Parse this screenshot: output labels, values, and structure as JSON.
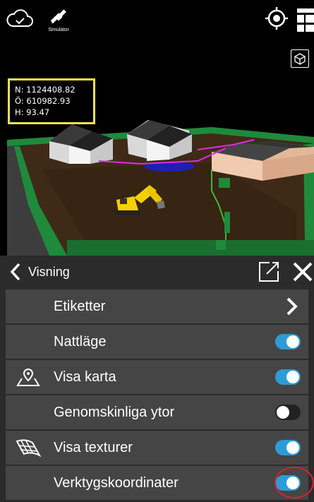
{
  "top_bar": {
    "cloud_icon": "cloud-check-icon",
    "gps_icon": "satellite-icon",
    "gps_label": "Simulator",
    "locate_icon": "crosshair-icon",
    "layers_icon": "layers-icon",
    "view_cube_icon": "cube-icon"
  },
  "coordinates": {
    "n": "N: 1124408.82",
    "o": "Ö: 610982.93",
    "h": "H: 93.47",
    "border_color": "#f2e05c"
  },
  "panel": {
    "title": "Visning",
    "back_icon": "chevron-left-icon",
    "open_icon": "external-link-icon",
    "close_icon": "close-icon",
    "items": [
      {
        "label": "Etiketter",
        "control": "chevron",
        "icon": ""
      },
      {
        "label": "Nattläge",
        "control": "toggle",
        "checked": true,
        "icon": ""
      },
      {
        "label": "Visa karta",
        "control": "toggle",
        "checked": true,
        "icon": "map-pin-icon"
      },
      {
        "label": "Genomskinliga ytor",
        "control": "toggle",
        "checked": false,
        "icon": ""
      },
      {
        "label": "Visa texturer",
        "control": "toggle",
        "checked": true,
        "icon": "texture-icon"
      },
      {
        "label": "Verktygskoordinater",
        "control": "toggle",
        "checked": true,
        "icon": ""
      }
    ]
  },
  "colors": {
    "toggle_on": "#2d9bd6",
    "panel_bg": "#2b2b2b",
    "row_bg": "#454545",
    "highlight_ring": "#d9232d"
  }
}
